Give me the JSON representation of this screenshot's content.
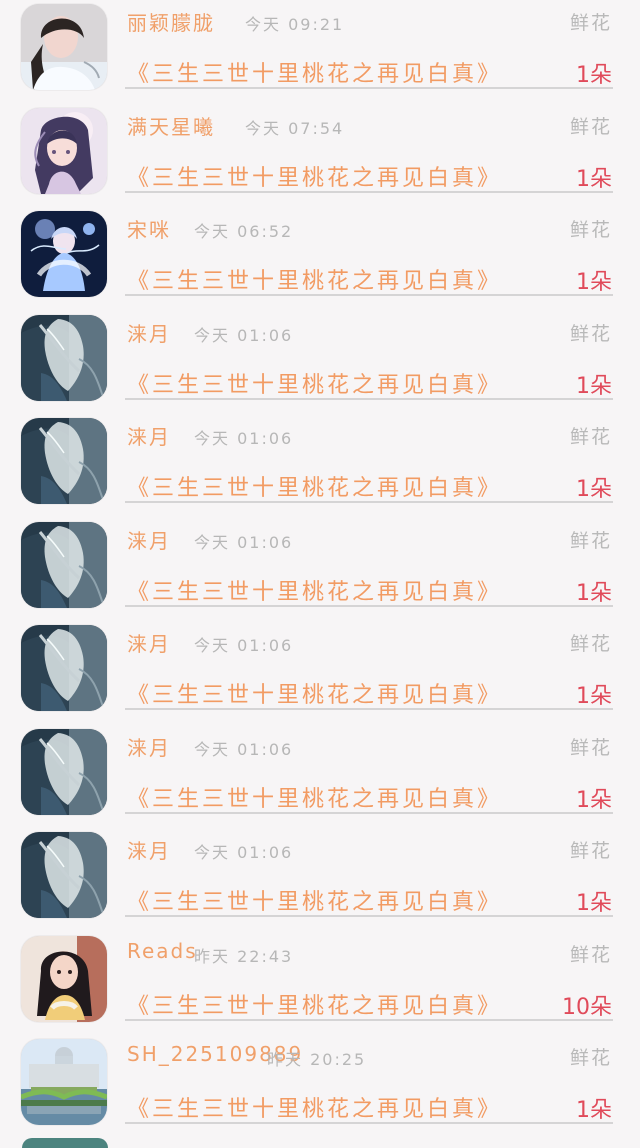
{
  "records": [
    {
      "name": "丽颖朦胧",
      "time": "今天 09:21",
      "gift_type": "鲜花",
      "gift_name": "《三生三世十里桃花之再见白真》",
      "count": "1朵",
      "avatar": "avatar-a"
    },
    {
      "name": "满天星曦",
      "time": "今天 07:54",
      "gift_type": "鲜花",
      "gift_name": "《三生三世十里桃花之再见白真》",
      "count": "1朵",
      "avatar": "avatar-b"
    },
    {
      "name": "宋咪",
      "time": "今天 06:52",
      "gift_type": "鲜花",
      "gift_name": "《三生三世十里桃花之再见白真》",
      "count": "1朵",
      "avatar": "avatar-c"
    },
    {
      "name": "涞月",
      "time": "今天 01:06",
      "gift_type": "鲜花",
      "gift_name": "《三生三世十里桃花之再见白真》",
      "count": "1朵",
      "avatar": "avatar-d"
    },
    {
      "name": "涞月",
      "time": "今天 01:06",
      "gift_type": "鲜花",
      "gift_name": "《三生三世十里桃花之再见白真》",
      "count": "1朵",
      "avatar": "avatar-d"
    },
    {
      "name": "涞月",
      "time": "今天 01:06",
      "gift_type": "鲜花",
      "gift_name": "《三生三世十里桃花之再见白真》",
      "count": "1朵",
      "avatar": "avatar-d"
    },
    {
      "name": "涞月",
      "time": "今天 01:06",
      "gift_type": "鲜花",
      "gift_name": "《三生三世十里桃花之再见白真》",
      "count": "1朵",
      "avatar": "avatar-d"
    },
    {
      "name": "涞月",
      "time": "今天 01:06",
      "gift_type": "鲜花",
      "gift_name": "《三生三世十里桃花之再见白真》",
      "count": "1朵",
      "avatar": "avatar-d"
    },
    {
      "name": "涞月",
      "time": "今天 01:06",
      "gift_type": "鲜花",
      "gift_name": "《三生三世十里桃花之再见白真》",
      "count": "1朵",
      "avatar": "avatar-d"
    },
    {
      "name": "Reads",
      "time": "昨天 22:43",
      "gift_type": "鲜花",
      "gift_name": "《三生三世十里桃花之再见白真》",
      "count": "10朵",
      "avatar": "avatar-e"
    },
    {
      "name": "SH_225109889",
      "time": "昨天 20:25",
      "gift_type": "鲜花",
      "gift_name": "《三生三世十里桃花之再见白真》",
      "count": "1朵",
      "avatar": "avatar-f"
    }
  ],
  "colors": {
    "background": "#f7f5f6",
    "name": "#f0a06a",
    "gift_name": "#f29b63",
    "count": "#e04a5a",
    "meta": "#b7b7b7",
    "divider": "#d5d4d5"
  }
}
